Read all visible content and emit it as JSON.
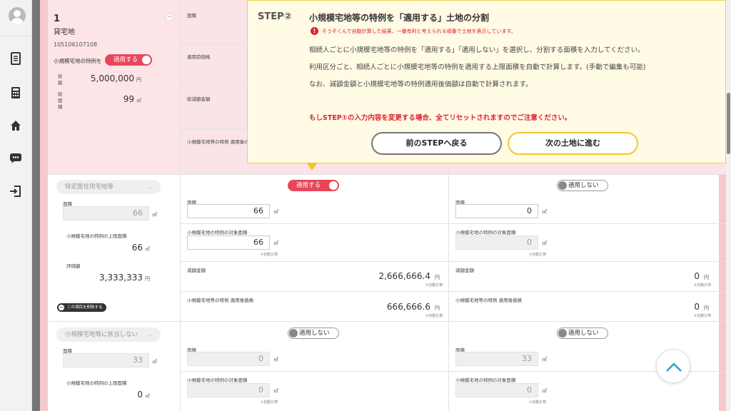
{
  "step": {
    "label": "STEP②",
    "title": "小規模宅地等の特例を「適用する」土地の分割",
    "warning": "そうぞくんで自動計算した結果、一番有利と考えられる順番で土地を表示しています。",
    "line1": "相続人ごとに小規模宅地等の特例を「適用する」「適用しない」を選択し、分割する面積を入力してください。",
    "line2": "利用区分ごと、相続人ごとに小規模宅地等の特例を適用する上限面積を自動で計算します。(手動で編集も可能)",
    "line3": "なお、減額金額と小規模宅地等の特例適用後価額は自動で計算されます。",
    "reset_warning": "もしSTEP①の入力内容を変更する場合、全てリセットされますのでご注意ください。",
    "back_button": "前のSTEPへ戻る",
    "next_button": "次の土地に進む"
  },
  "land": {
    "number": "1",
    "type": "貸宅地",
    "code": "105106107108",
    "special_label": "小規模宅地の特例を",
    "toggle": "適用する",
    "total_amount_label": "総額",
    "total_amount": "5,000,000",
    "total_amount_unit": "円",
    "total_area_label": "総面積",
    "total_area": "99",
    "area_unit": "㎡"
  },
  "header_labels": {
    "area": "面積",
    "pre_price": "適用前価格",
    "total_reduction": "総減額金額",
    "post_price": "小規模宅地等の特例 適用後の"
  },
  "section1": {
    "select": "特定居住用宅地等",
    "area_label": "面積",
    "area_value": "66",
    "limit_label": "小規模宅地の特例の上限面積",
    "limit_value": "66",
    "valuation_label": "評価額",
    "valuation": "3,333,333",
    "yen": "円",
    "delete_button": "この項目を削除する",
    "col1": {
      "toggle": "適用する",
      "area_label": "面積",
      "area": "66",
      "target_label": "小規模宅地の特例の対象面積",
      "target": "66",
      "auto": "※自動計算",
      "reduction_label": "減額金額",
      "reduction": "2,666,666.4",
      "post_label": "小規模宅地等の特例 適用後価格",
      "post": "666,666.6"
    },
    "col2": {
      "toggle": "適用しない",
      "area_label": "面積",
      "area": "0",
      "target_label": "小規模宅地の特例の対象面積",
      "target": "0",
      "auto": "※自動計算",
      "reduction_label": "減額金額",
      "reduction": "0",
      "post_label": "小規模宅地等の特例 適用後価格",
      "post": "0"
    }
  },
  "section2": {
    "select": "小規模宅地等に該当しない",
    "area_label": "面積",
    "area_value": "33",
    "limit_label": "小規模宅地の特例の上限面積",
    "limit_value": "0",
    "col1": {
      "toggle": "適用しない",
      "area_label": "面積",
      "area": "0",
      "target_label": "小規模宅地の特例の対象面積",
      "target": "0",
      "auto": "※自動計算"
    },
    "col2": {
      "toggle": "適用しない",
      "area_label": "面積",
      "area": "33",
      "target_label": "小規模宅地の特例の対象面積",
      "target": "0",
      "auto": "※自動計算"
    }
  }
}
